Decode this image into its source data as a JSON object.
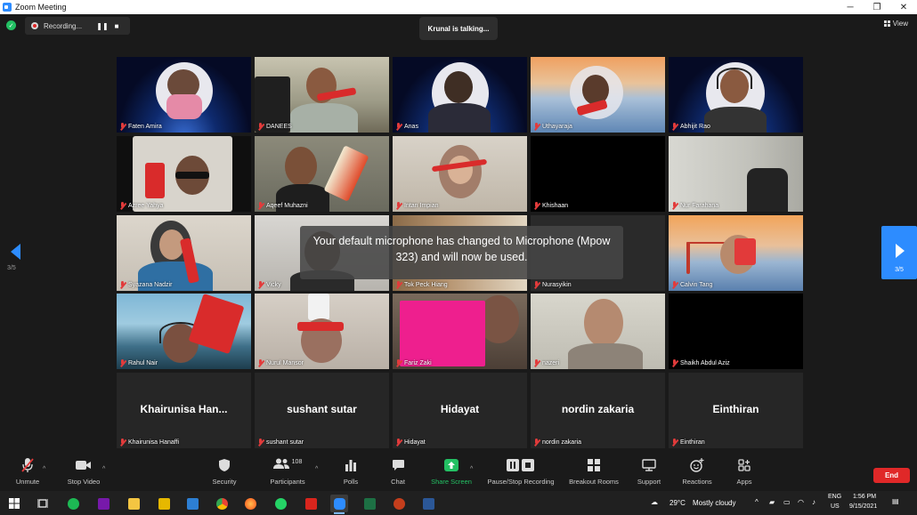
{
  "window": {
    "title": "Zoom Meeting",
    "minimize": "─",
    "maximize": "❐",
    "close": "✕"
  },
  "topbar": {
    "recording_label": "Recording...",
    "pause_icon": "❚❚",
    "stop_icon": "■",
    "speaker_indicator": "Krunal is talking...",
    "view_label": "View"
  },
  "paging": {
    "left": "3/5",
    "right": "3/5"
  },
  "notification": "Your default microphone has changed to Microphone (Mpow 323) and will now be used.",
  "tiles": [
    {
      "name": "Faten Amira"
    },
    {
      "name": "DANEES"
    },
    {
      "name": "Anas"
    },
    {
      "name": "Uthayaraja"
    },
    {
      "name": "Abhijit Rao"
    },
    {
      "name": "Azree Yahya"
    },
    {
      "name": "Aqeef Muhazni"
    },
    {
      "name": "Intan Impian"
    },
    {
      "name": "Khishaan"
    },
    {
      "name": "Nur Farahana"
    },
    {
      "name": "Syazana Nadzir"
    },
    {
      "name": "Vicky"
    },
    {
      "name": "Tok Peck Hiang"
    },
    {
      "name": "Nurasyikin"
    },
    {
      "name": "Calvin Tang"
    },
    {
      "name": "Rahul Nair"
    },
    {
      "name": "Nurul Mansor"
    },
    {
      "name": "Fariz Zaki"
    },
    {
      "name": "nazeri"
    },
    {
      "name": "Shaikh Abdul Aziz"
    },
    {
      "name": "Khairunisa Hanaffi",
      "display": "Khairunisa  Han..."
    },
    {
      "name": "sushant sutar",
      "display": "sushant sutar"
    },
    {
      "name": "Hidayat",
      "display": "Hidayat"
    },
    {
      "name": "nordin zakaria",
      "display": "nordin zakaria"
    },
    {
      "name": "Einthiran",
      "display": "Einthiran"
    }
  ],
  "toolbar": {
    "unmute": "Unmute",
    "stop_video": "Stop Video",
    "security": "Security",
    "participants": "Participants",
    "participants_count": "108",
    "polls": "Polls",
    "chat": "Chat",
    "share_screen": "Share Screen",
    "pause_stop_recording": "Pause/Stop Recording",
    "breakout_rooms": "Breakout Rooms",
    "support": "Support",
    "reactions": "Reactions",
    "apps": "Apps",
    "end": "End"
  },
  "taskbar": {
    "weather_temp": "29°C",
    "weather_text": "Mostly cloudy",
    "lang": "ENG",
    "region": "US",
    "time": "1:56 PM",
    "date": "9/15/2021"
  },
  "colors": {
    "accent": "#2d8cff",
    "end": "#e02828",
    "share": "#23c063"
  }
}
